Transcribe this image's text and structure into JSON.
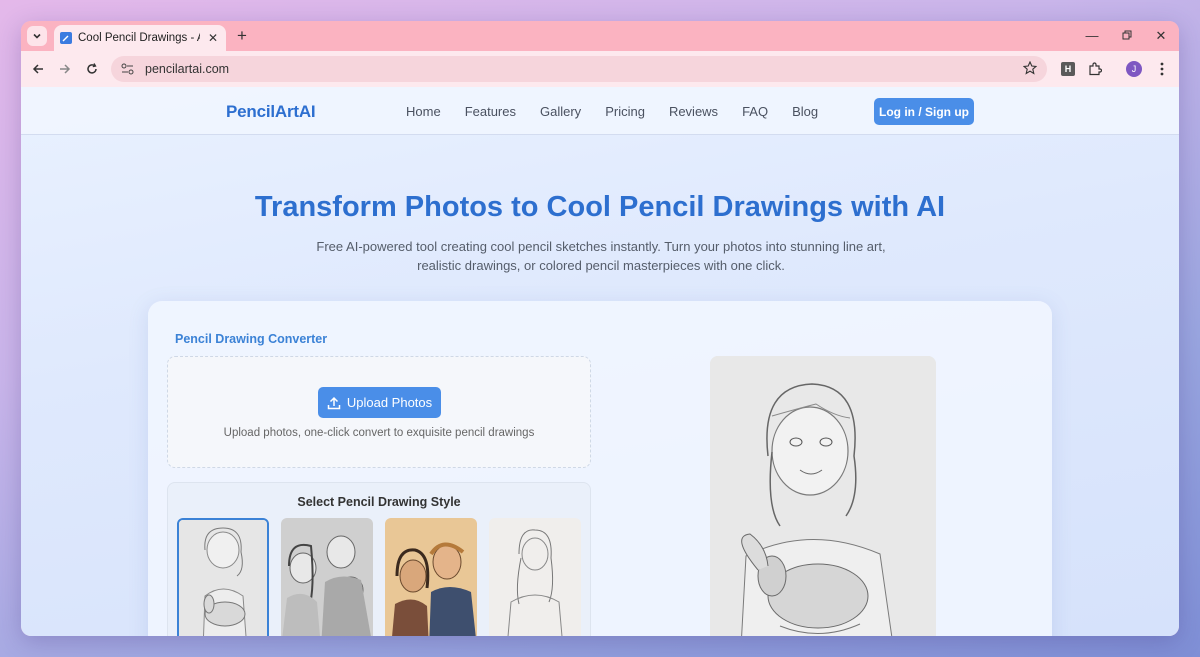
{
  "browser": {
    "tab_title": "Cool Pencil Drawings - AI Photo",
    "url": "pencilartai.com",
    "profile_initial": "J",
    "extension_label": "H"
  },
  "site": {
    "logo": "PencilArtAI",
    "nav": [
      "Home",
      "Features",
      "Gallery",
      "Pricing",
      "Reviews",
      "FAQ",
      "Blog"
    ],
    "login_label": "Log in / Sign up"
  },
  "hero": {
    "title": "Transform Photos to Cool Pencil Drawings with AI",
    "subtitle": "Free AI-powered tool creating cool pencil sketches instantly. Turn your photos into stunning line art, realistic drawings, or colored pencil masterpieces with one click."
  },
  "converter": {
    "title": "Pencil Drawing Converter",
    "upload_label": "Upload Photos",
    "upload_hint": "Upload photos, one-click convert to exquisite pencil drawings",
    "style_title": "Select Pencil Drawing Style"
  },
  "colors": {
    "accent": "#4a8ee8",
    "brand": "#2d6fd0",
    "tabstrip": "#fbb3c1"
  }
}
